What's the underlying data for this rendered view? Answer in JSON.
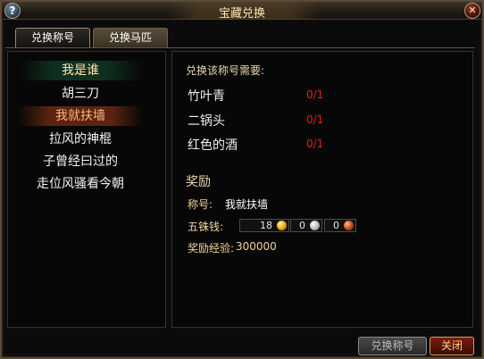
{
  "window": {
    "title": "宝藏兑换"
  },
  "tabs": [
    {
      "label": "兑换称号",
      "active": true
    },
    {
      "label": "兑换马匹",
      "active": false
    }
  ],
  "title_list": [
    {
      "label": "我是谁",
      "state": "highlight"
    },
    {
      "label": "胡三刀",
      "state": "normal"
    },
    {
      "label": "我就扶墙",
      "state": "selected"
    },
    {
      "label": "拉风的神棍",
      "state": "normal"
    },
    {
      "label": "子曾经曰过的",
      "state": "normal"
    },
    {
      "label": "走位风骚看今朝",
      "state": "normal"
    }
  ],
  "requirements": {
    "heading": "兑换该称号需要:",
    "items": [
      {
        "name": "竹叶青",
        "count": "0/1"
      },
      {
        "name": "二锅头",
        "count": "0/1"
      },
      {
        "name": "红色的酒",
        "count": "0/1"
      }
    ]
  },
  "reward": {
    "title": "奖励",
    "name_label": "称号:",
    "name_value": "我就扶墙",
    "money_label": "五铢钱:",
    "gold": "18",
    "silver": "0",
    "copper": "0",
    "exp_label": "奖励经验:",
    "exp_value": "300000"
  },
  "buttons": {
    "exchange": "兑换称号",
    "close": "关闭"
  },
  "colors": {
    "count_red": "#e0231e",
    "gold_text": "#f2d59a",
    "selected_bg": "#5a2410",
    "highlight_bg": "#0f3020"
  }
}
